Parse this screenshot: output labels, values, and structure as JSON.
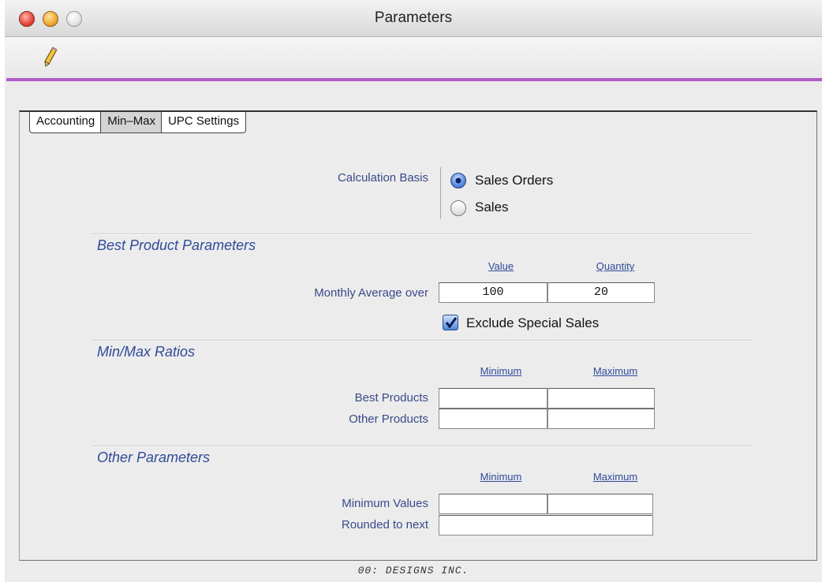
{
  "window": {
    "title": "Parameters"
  },
  "toolbar": {
    "edit_icon": "pencil-icon"
  },
  "accent_color": "#b05bc9",
  "tabs": [
    {
      "label": "Accounting",
      "active": false
    },
    {
      "label": "Min–Max",
      "active": true
    },
    {
      "label": "UPC Settings",
      "active": false
    }
  ],
  "calculation_basis": {
    "label": "Calculation Basis",
    "options": [
      {
        "label": "Sales Orders",
        "selected": true
      },
      {
        "label": "Sales",
        "selected": false
      }
    ]
  },
  "best_product": {
    "heading": "Best Product Parameters",
    "col_value": "Value",
    "col_quantity": "Quantity",
    "row_label": "Monthly Average over",
    "value": "100",
    "quantity": "20",
    "exclude_label": "Exclude Special Sales",
    "exclude_checked": true
  },
  "minmax": {
    "heading": "Min/Max Ratios",
    "col_min": "Minimum",
    "col_max": "Maximum",
    "rows": [
      {
        "label": "Best Products",
        "min": "",
        "max": ""
      },
      {
        "label": "Other Products",
        "min": "",
        "max": ""
      }
    ]
  },
  "other": {
    "heading": "Other Parameters",
    "col_min": "Minimum",
    "col_max": "Maximum",
    "min_values_label": "Minimum Values",
    "min_values_min": "",
    "min_values_max": "",
    "rounded_label": "Rounded to next",
    "rounded_value": ""
  },
  "footer": {
    "text": "00: DESIGNS INC."
  }
}
